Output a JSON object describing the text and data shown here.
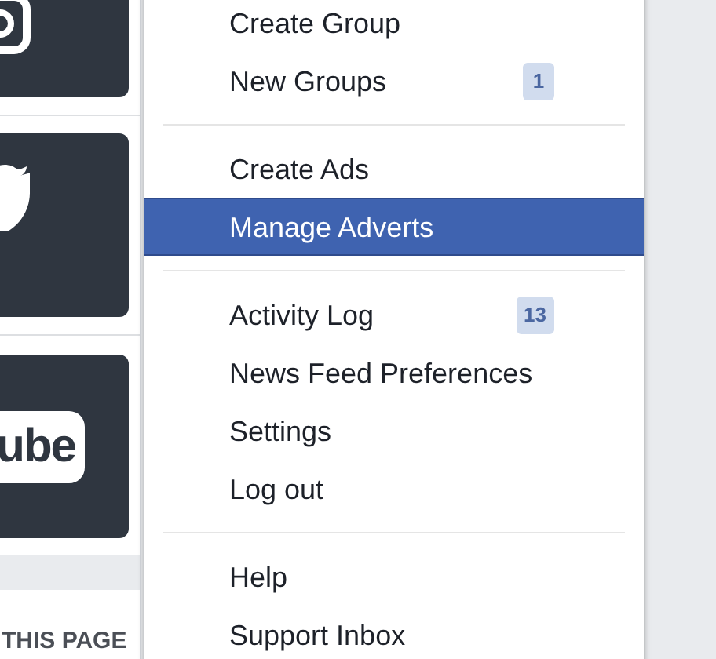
{
  "page": {
    "tiles": [
      {
        "kind": "instagram"
      },
      {
        "kind": "twitter"
      },
      {
        "kind": "youtube",
        "logo_text": "ube"
      }
    ],
    "section_heading": "THIS PAGE"
  },
  "menu": {
    "sections": [
      [
        {
          "label": "Create Group",
          "selected": false
        },
        {
          "label": "New Groups",
          "badge": "1",
          "selected": false
        }
      ],
      [
        {
          "label": "Create Ads",
          "selected": false
        },
        {
          "label": "Manage Adverts",
          "selected": true
        }
      ],
      [
        {
          "label": "Activity Log",
          "badge": "13",
          "selected": false
        },
        {
          "label": "News Feed Preferences",
          "selected": false
        },
        {
          "label": "Settings",
          "selected": false
        },
        {
          "label": "Log out",
          "selected": false
        }
      ],
      [
        {
          "label": "Help",
          "selected": false
        },
        {
          "label": "Support Inbox",
          "selected": false
        }
      ]
    ]
  }
}
